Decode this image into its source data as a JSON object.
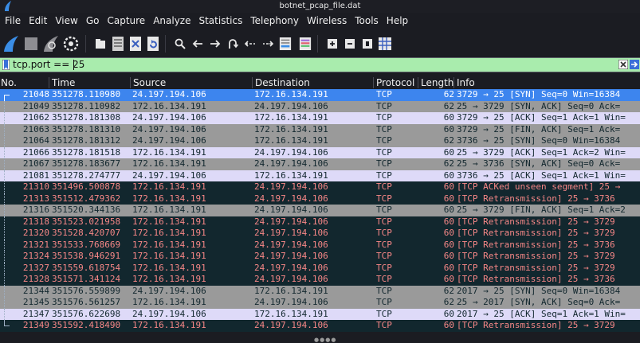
{
  "window": {
    "title": "botnet_pcap_file.dat"
  },
  "menu": [
    "File",
    "Edit",
    "View",
    "Go",
    "Capture",
    "Analyze",
    "Statistics",
    "Telephony",
    "Wireless",
    "Tools",
    "Help"
  ],
  "toolbar": {
    "buttons": [
      "start-capture-icon",
      "stop-capture-icon",
      "restart-capture-icon",
      "capture-options-icon",
      "open-file-icon",
      "save-file-icon",
      "close-file-icon",
      "reload-file-icon",
      "find-packet-icon",
      "go-back-icon",
      "go-forward-icon",
      "go-to-packet-icon",
      "first-packet-icon",
      "last-packet-icon",
      "auto-scroll-icon",
      "colorize-icon",
      "zoom-in-icon",
      "zoom-out-icon",
      "normal-size-icon",
      "resize-columns-icon"
    ]
  },
  "filter": {
    "value": "tcp.port == 25"
  },
  "columns": {
    "no": "No.",
    "time": "Time",
    "source": "Source",
    "destination": "Destination",
    "protocol": "Protocol",
    "length": "Length",
    "info": "Info"
  },
  "colors": {
    "selected_bg": "#3d85ee",
    "selected_fg": "#ffffff",
    "syn_bg": "#9a9a9a",
    "normal_bg": "#dedaf8",
    "normal_fg": "#12272e",
    "bad_bg": "#12272e",
    "bad_fg": "#f78787",
    "menu_fg": "#f0f0f0",
    "app_bg": "#1b1c22",
    "filter_bg": "#a9ecad"
  },
  "packets": [
    {
      "no": "21048",
      "time": "351278.110980",
      "src": "24.197.194.106",
      "dst": "172.16.134.191",
      "proto": "TCP",
      "len": "62",
      "info": "3729 → 25 [SYN] Seq=0 Win=16384",
      "style": "selected"
    },
    {
      "no": "21049",
      "time": "351278.110982",
      "src": "172.16.134.191",
      "dst": "24.197.194.106",
      "proto": "TCP",
      "len": "62",
      "info": "25 → 3729 [SYN, ACK] Seq=0 Ack=",
      "style": "syn"
    },
    {
      "no": "21062",
      "time": "351278.181308",
      "src": "24.197.194.106",
      "dst": "172.16.134.191",
      "proto": "TCP",
      "len": "60",
      "info": "3729 → 25 [ACK] Seq=1 Ack=1 Win=",
      "style": "normal"
    },
    {
      "no": "21063",
      "time": "351278.181310",
      "src": "24.197.194.106",
      "dst": "172.16.134.191",
      "proto": "TCP",
      "len": "60",
      "info": "3729 → 25 [FIN, ACK] Seq=1 Ack=",
      "style": "syn"
    },
    {
      "no": "21064",
      "time": "351278.181312",
      "src": "24.197.194.106",
      "dst": "172.16.134.191",
      "proto": "TCP",
      "len": "62",
      "info": "3736 → 25 [SYN] Seq=0 Win=16384",
      "style": "syn"
    },
    {
      "no": "21066",
      "time": "351278.181518",
      "src": "172.16.134.191",
      "dst": "24.197.194.106",
      "proto": "TCP",
      "len": "60",
      "info": "25 → 3729 [ACK] Seq=1 Ack=2 Win=",
      "style": "normal"
    },
    {
      "no": "21067",
      "time": "351278.183677",
      "src": "172.16.134.191",
      "dst": "24.197.194.106",
      "proto": "TCP",
      "len": "62",
      "info": "25 → 3736 [SYN, ACK] Seq=0 Ack=",
      "style": "syn"
    },
    {
      "no": "21081",
      "time": "351278.274777",
      "src": "24.197.194.106",
      "dst": "172.16.134.191",
      "proto": "TCP",
      "len": "60",
      "info": "3736 → 25 [ACK] Seq=1 Ack=1 Win=",
      "style": "normal"
    },
    {
      "no": "21310",
      "time": "351496.500878",
      "src": "172.16.134.191",
      "dst": "24.197.194.106",
      "proto": "TCP",
      "len": "60",
      "info": "[TCP ACKed unseen segment] 25 →",
      "style": "bad"
    },
    {
      "no": "21313",
      "time": "351512.479362",
      "src": "172.16.134.191",
      "dst": "24.197.194.106",
      "proto": "TCP",
      "len": "60",
      "info": "[TCP Retransmission] 25 → 3736",
      "style": "bad"
    },
    {
      "no": "21316",
      "time": "351520.344136",
      "src": "172.16.134.191",
      "dst": "24.197.194.106",
      "proto": "TCP",
      "len": "60",
      "info": "25 → 3729 [FIN, ACK] Seq=1 Ack=2",
      "style": "syn"
    },
    {
      "no": "21318",
      "time": "351523.021958",
      "src": "172.16.134.191",
      "dst": "24.197.194.106",
      "proto": "TCP",
      "len": "60",
      "info": "[TCP Retransmission] 25 → 3729",
      "style": "bad"
    },
    {
      "no": "21320",
      "time": "351528.420707",
      "src": "172.16.134.191",
      "dst": "24.197.194.106",
      "proto": "TCP",
      "len": "60",
      "info": "[TCP Retransmission] 25 → 3729",
      "style": "bad"
    },
    {
      "no": "21321",
      "time": "351533.768669",
      "src": "172.16.134.191",
      "dst": "24.197.194.106",
      "proto": "TCP",
      "len": "60",
      "info": "[TCP Retransmission] 25 → 3736",
      "style": "bad"
    },
    {
      "no": "21324",
      "time": "351538.946291",
      "src": "172.16.134.191",
      "dst": "24.197.194.106",
      "proto": "TCP",
      "len": "60",
      "info": "[TCP Retransmission] 25 → 3729",
      "style": "bad"
    },
    {
      "no": "21327",
      "time": "351559.618754",
      "src": "172.16.134.191",
      "dst": "24.197.194.106",
      "proto": "TCP",
      "len": "60",
      "info": "[TCP Retransmission] 25 → 3729",
      "style": "bad"
    },
    {
      "no": "21328",
      "time": "351571.341124",
      "src": "172.16.134.191",
      "dst": "24.197.194.106",
      "proto": "TCP",
      "len": "60",
      "info": "[TCP Retransmission] 25 → 3736",
      "style": "bad"
    },
    {
      "no": "21344",
      "time": "351576.559899",
      "src": "24.197.194.106",
      "dst": "172.16.134.191",
      "proto": "TCP",
      "len": "62",
      "info": "2017 → 25 [SYN] Seq=0 Win=16384",
      "style": "syn"
    },
    {
      "no": "21345",
      "time": "351576.561257",
      "src": "172.16.134.191",
      "dst": "24.197.194.106",
      "proto": "TCP",
      "len": "62",
      "info": "25 → 2017 [SYN, ACK] Seq=0 Ack=",
      "style": "syn"
    },
    {
      "no": "21347",
      "time": "351576.622698",
      "src": "24.197.194.106",
      "dst": "172.16.134.191",
      "proto": "TCP",
      "len": "60",
      "info": "2017 → 25 [ACK] Seq=1 Ack=1 Win=",
      "style": "normal"
    },
    {
      "no": "21349",
      "time": "351592.418490",
      "src": "172.16.134.191",
      "dst": "24.197.194.106",
      "proto": "TCP",
      "len": "60",
      "info": "[TCP Retransmission] 25 → 3729",
      "style": "bad"
    }
  ]
}
